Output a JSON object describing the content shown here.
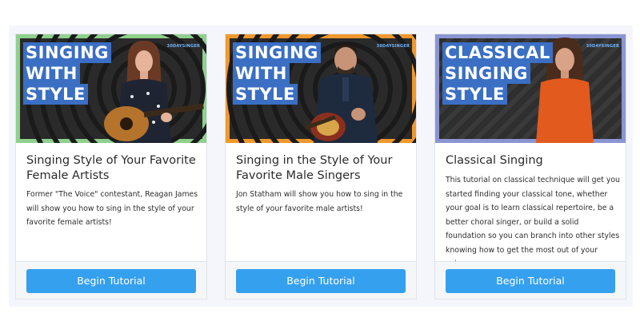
{
  "cards": [
    {
      "banner": [
        "SINGING",
        "WITH",
        "STYLE"
      ],
      "brand": "30DAYSINGER",
      "frame_color": "#8fd08c",
      "title": "Singing Style of Your Favorite Female Artists",
      "description": "Former \"The Voice\" contestant, Reagan James will show you how to sing in the style of your favorite female artists!",
      "button": "Begin Tutorial"
    },
    {
      "banner": [
        "SINGING",
        "WITH",
        "STYLE"
      ],
      "brand": "30DAYSINGER",
      "frame_color": "#f0982c",
      "title": "Singing in the Style of Your Favorite Male Singers",
      "description": "Jon Statham will show you how to sing in the style of your favorite male artists!",
      "button": "Begin Tutorial"
    },
    {
      "banner": [
        "CLASSICAL",
        "SINGING",
        "STYLE"
      ],
      "brand": "30DAYSINGER",
      "frame_color": "#8b95d2",
      "title": "Classical Singing",
      "description": "This tutorial on classical technique will get you started finding your classical tone, whether your goal is to learn classical repertoire, be a better choral singer, or build a solid foundation so you can branch into other styles knowing how to get the most out of your voice.",
      "button": "Begin Tutorial"
    }
  ],
  "colors": {
    "button": "#35a0ee",
    "banner_highlight": "#3a6fc4",
    "panel_bg": "#f4f6fb"
  }
}
